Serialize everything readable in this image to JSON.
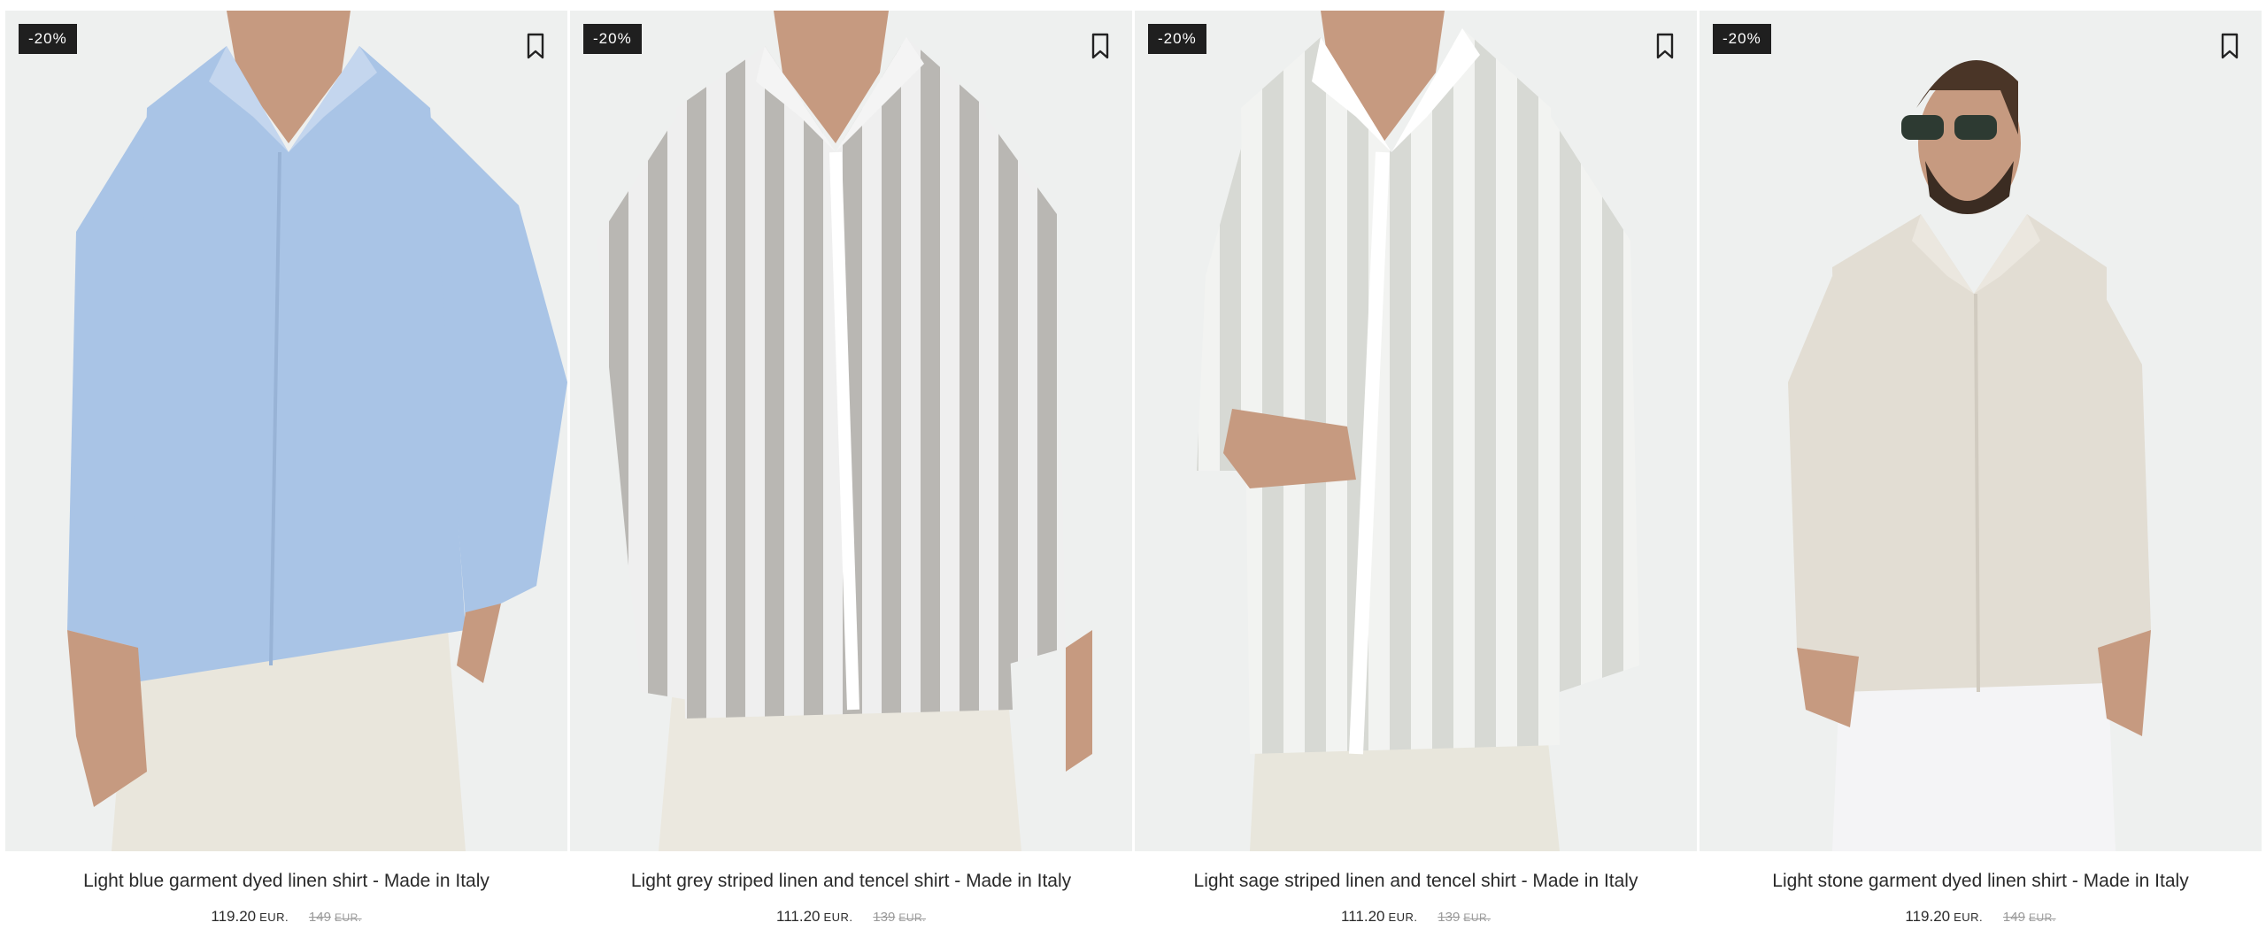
{
  "products": [
    {
      "badge": "-20%",
      "title": "Light blue garment dyed linen shirt - Made in Italy",
      "price": "119.20",
      "currency": "EUR.",
      "old_price": "149",
      "old_currency": "EUR.",
      "shirt_color": "#a9c4e6",
      "pants_color": "#e9e6dc",
      "stripes": false
    },
    {
      "badge": "-20%",
      "title": "Light grey striped linen and tencel shirt - Made in Italy",
      "price": "111.20",
      "currency": "EUR.",
      "old_price": "139",
      "old_currency": "EUR.",
      "shirt_color": "#efefef",
      "stripe_color": "#b9b7b3",
      "pants_color": "#ebe8df",
      "stripes": true
    },
    {
      "badge": "-20%",
      "title": "Light sage striped linen and tencel shirt - Made in Italy",
      "price": "111.20",
      "currency": "EUR.",
      "old_price": "139",
      "old_currency": "EUR.",
      "shirt_color": "#f2f3f1",
      "stripe_color": "#d7d9d4",
      "pants_color": "#e8e6dc",
      "stripes": true
    },
    {
      "badge": "-20%",
      "title": "Light stone garment dyed linen shirt - Made in Italy",
      "price": "119.20",
      "currency": "EUR.",
      "old_price": "149",
      "old_currency": "EUR.",
      "shirt_color": "#e2ddd3",
      "pants_color": "#f4f4f6",
      "stripes": false
    }
  ],
  "icons": {
    "wishlist": "bookmark-icon"
  },
  "colors": {
    "badge_bg": "#1f1f1f",
    "image_bg": "#eceeed",
    "skin": "#c69a80"
  }
}
